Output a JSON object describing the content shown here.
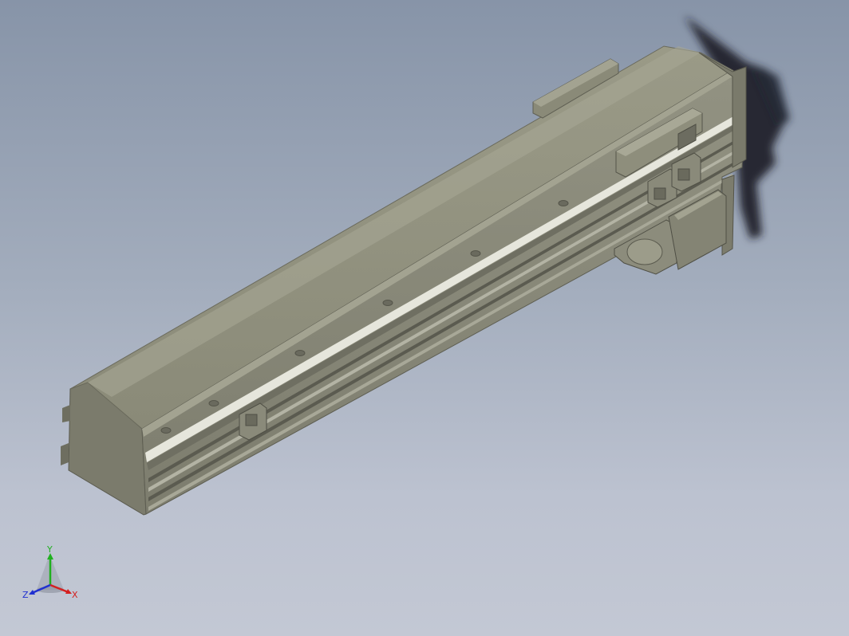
{
  "viewport": {
    "background_top": "#8794a8",
    "background_bottom": "#c3c8d4"
  },
  "model": {
    "body_color": "#8c8c7a",
    "shade_color": "#6f6f62",
    "highlight_color": "#a9a998",
    "shadow_color": "#1c1f28"
  },
  "triad": {
    "x_label": "X",
    "y_label": "Y",
    "z_label": "Z",
    "x_color": "#d42020",
    "y_color": "#20b020",
    "z_color": "#2030d0"
  }
}
